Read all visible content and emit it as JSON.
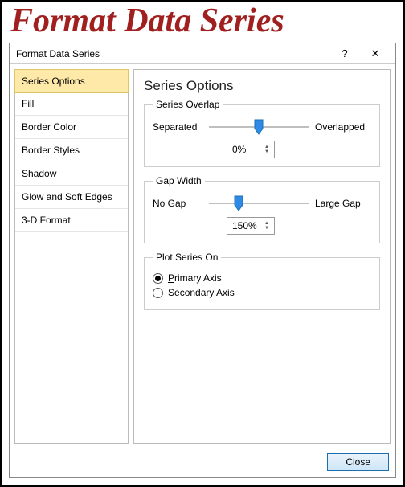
{
  "page_header": "Format Data Series",
  "dialog_title": "Format Data Series",
  "help_symbol": "?",
  "close_symbol": "✕",
  "sidebar": {
    "items": [
      {
        "label": "Series Options",
        "selected": true
      },
      {
        "label": "Fill"
      },
      {
        "label": "Border Color"
      },
      {
        "label": "Border Styles"
      },
      {
        "label": "Shadow"
      },
      {
        "label": "Glow and Soft Edges"
      },
      {
        "label": "3-D Format"
      }
    ]
  },
  "panel": {
    "heading": "Series Options",
    "overlap": {
      "legend": "Series Overlap",
      "left": "Separated",
      "right": "Overlapped",
      "value": "0%",
      "thumb_pct": 50
    },
    "gap": {
      "legend": "Gap Width",
      "left": "No Gap",
      "right": "Large Gap",
      "value": "150%",
      "thumb_pct": 30
    },
    "plot_on": {
      "legend": "Plot Series On",
      "primary": "Primary Axis",
      "secondary": "Secondary Axis",
      "selected": "primary"
    }
  },
  "footer": {
    "close": "Close"
  }
}
